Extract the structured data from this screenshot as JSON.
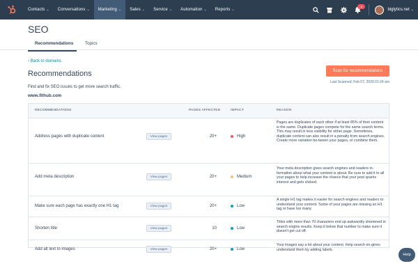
{
  "nav": {
    "logo_icon": "hubspot-sprocket-icon",
    "brand_color": "#ff7a59",
    "items": [
      {
        "label": "Contacts",
        "active": false
      },
      {
        "label": "Conversations",
        "active": false
      },
      {
        "label": "Marketing",
        "active": true
      },
      {
        "label": "Sales",
        "active": false
      },
      {
        "label": "Service",
        "active": false
      },
      {
        "label": "Automation",
        "active": false
      },
      {
        "label": "Reports",
        "active": false
      }
    ],
    "right_icons": [
      "search-icon",
      "marketplace-icon",
      "settings-icon",
      "notifications-icon"
    ],
    "notification_count": "1",
    "account_label": "biglytics.net"
  },
  "page": {
    "title": "SEO",
    "tabs": [
      {
        "label": "Recommendations",
        "active": true
      },
      {
        "label": "Topics",
        "active": false
      }
    ],
    "back_link": "‹ Back to domains",
    "section_title": "Recommendations",
    "subtitle": "Find and fix SEO issues to get more search traffic.",
    "domain": "www.fithub.com",
    "scan_button": "Scan for recommendations",
    "last_scanned": "Last Scanned: Feb 07, 2020 01:24 am"
  },
  "table": {
    "headers": {
      "recommendations": "RECOMMENDATIONS",
      "pages_affected": "PAGES AFFECTED",
      "impact": "IMPACT",
      "reason": "REASON"
    },
    "view_label": "View pages",
    "impact_colors": {
      "High": "#f2545b",
      "Medium": "#f5c26b",
      "Low": "#00a4bd"
    },
    "rows": [
      {
        "recommendation": "Address pages with duplicate content",
        "pages": "20+",
        "impact": "High",
        "reason": "Pages are duplicates of each other if at least 85% of their content is the same. Duplicate pages compete for the same search terms. This may result in less visibility for either page. Sometimes, duplicate content can also result in a penalty from search engines. Create more variation be-tween your pages, or combine them."
      },
      {
        "recommendation": "Add meta description",
        "pages": "20+",
        "impact": "Medium",
        "reason": "Your meta description gives search engines and readers in-formation about what your content is about. Be sure to add it to all your pages to help increase the chance that your post sparks interest and gets clicked."
      },
      {
        "recommendation": "Make sure each page has exactly one H1 tag",
        "pages": "20+",
        "impact": "Low",
        "reason": "A single H1 tag makes it easier for search engines and readers to understand your content. Some of your pages are missing an H1 tag or have too many."
      },
      {
        "recommendation": "Shorten title",
        "pages": "10",
        "impact": "Low",
        "reason": "Titles with more than 70 characters end up awkwardly shortened in search engine results. Keep it below that number to make sure it doesn't get cut off."
      },
      {
        "recommendation": "Add alt text to images",
        "pages": "20+",
        "impact": "Low",
        "reason": "Your images say a lot about your content. Help search en-gines understand them by adding labels."
      }
    ]
  },
  "help_label": "Help"
}
